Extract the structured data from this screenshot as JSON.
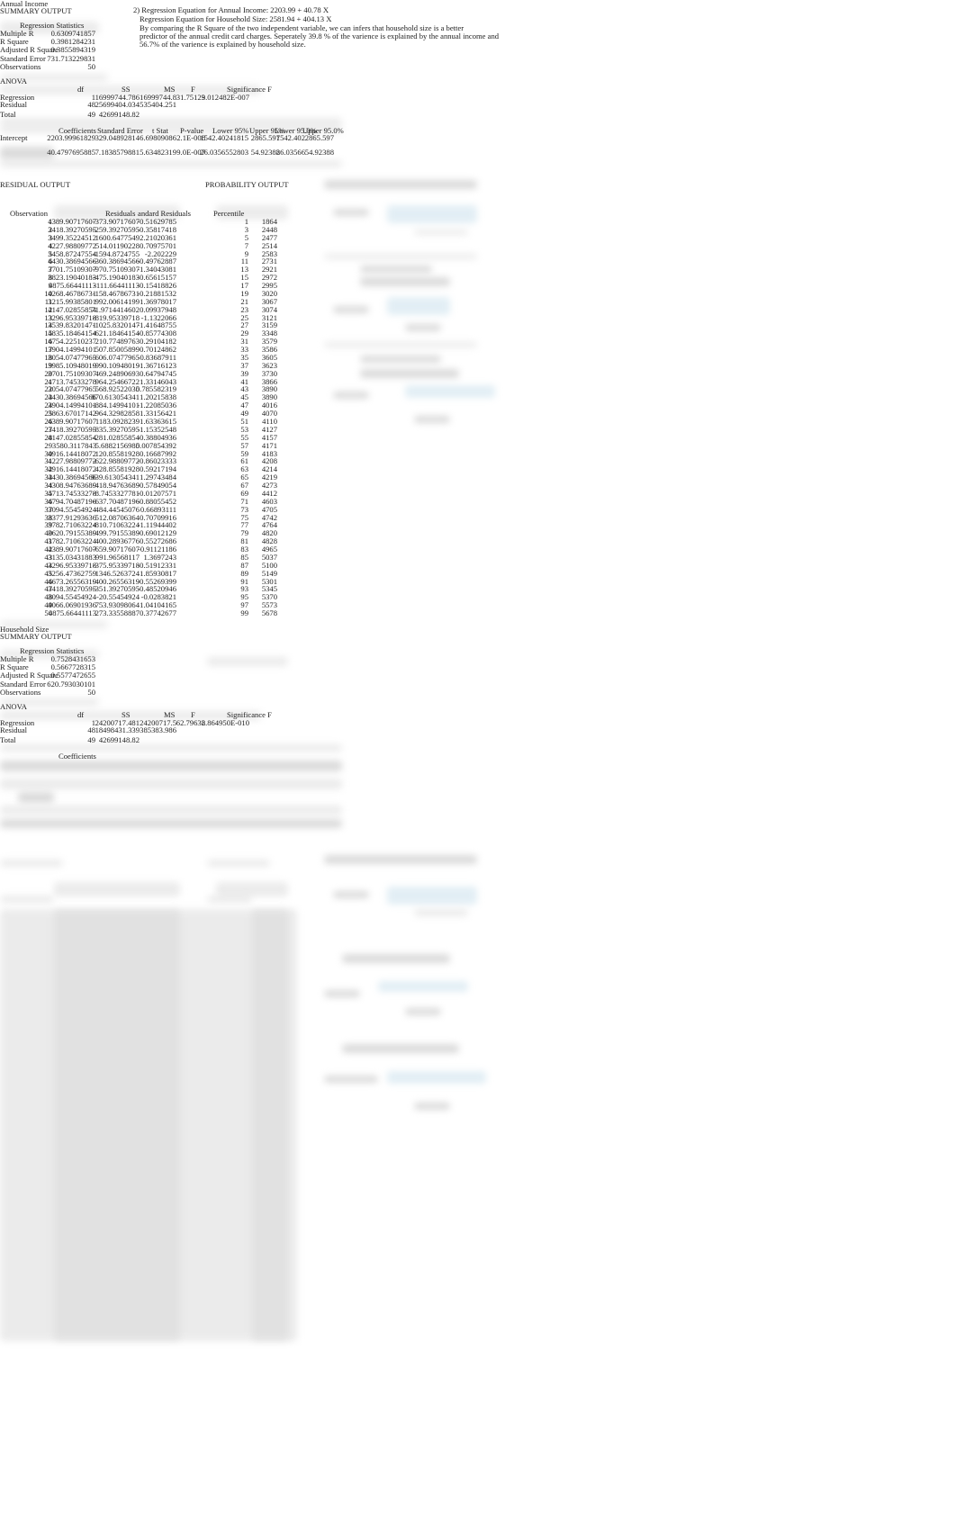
{
  "income": {
    "section_title": "Annual Income",
    "summary_title": "SUMMARY OUTPUT",
    "reg_stats_header": "Regression Statistics",
    "reg_stats": [
      {
        "label": "Multiple R",
        "value": "0.6309741857"
      },
      {
        "label": "R Square",
        "value": "0.3981284231"
      },
      {
        "label": "Adjusted R Square",
        "value": "0.3855894319"
      },
      {
        "label": "Standard Error",
        "value": "731.713229831"
      },
      {
        "label": "Observations",
        "value": "50"
      }
    ],
    "anova_title": "ANOVA",
    "anova_headers": [
      "df",
      "SS",
      "MS",
      "F",
      "Significance F"
    ],
    "anova_rows": [
      {
        "label": "Regression",
        "df": "1",
        "ss": "16999744.786",
        "ms": "16999744.8",
        "f": "31.75123",
        "sig": "9.012482E-007"
      },
      {
        "label": "Residual",
        "df": "48",
        "ss": "25699404.034",
        "ms": "535404.251",
        "f": "",
        "sig": ""
      },
      {
        "label": "Total",
        "df": "49",
        "ss": "42699148.82",
        "ms": "",
        "f": "",
        "sig": ""
      }
    ],
    "coef_headers": [
      "Coefficients",
      "Standard Error",
      "t Stat",
      "P-value",
      "Lower 95%",
      "Upper 95%",
      "Lower 95.0%",
      "Upper 95.0%"
    ],
    "coef_rows": [
      {
        "label": "Intercept",
        "values": [
          "2203.99961829",
          "329.04892814",
          "6.69809086",
          "2.1E-008",
          "1542.40241815",
          "2865.597",
          "1542.402",
          "2865.597"
        ]
      },
      {
        "label": "",
        "values": [
          "40.4797695885",
          "7.1838579881",
          "5.63482319",
          "9.0E-007",
          "26.0356552803",
          "54.92388",
          "26.03566",
          "54.92388"
        ]
      }
    ],
    "residual_title": "RESIDUAL OUTPUT",
    "residual_headers": [
      "Observation",
      "Residuals",
      "andard Residuals"
    ],
    "residual_rows": [
      [
        "1",
        "4389.90717607",
        "-373.90717607",
        "-0.51629785"
      ],
      [
        "2",
        "3418.39270595",
        "-259.39270595",
        "-0.35817418"
      ],
      [
        "3",
        "3499.35224512",
        "1600.6477549",
        "2.21020361"
      ],
      [
        "4",
        "4227.98809772",
        "514.01190228",
        "0.70975701"
      ],
      [
        "5",
        "3458.87247554",
        "-1594.8724755",
        "-2.202229"
      ],
      [
        "6",
        "4430.38694566",
        "-360.38694566",
        "-0.49762887"
      ],
      [
        "7",
        "3701.75109307",
        "-970.75109307",
        "-1.34043081"
      ],
      [
        "8",
        "3823.19040183",
        "-475.19040183",
        "-0.65615157"
      ],
      [
        "9",
        "4875.66441113",
        "-111.66441113",
        "-0.15418826"
      ],
      [
        "10",
        "4268.46786731",
        "-158.46786731",
        "-0.21881532"
      ],
      [
        "11",
        "3215.99385801",
        "992.00614199",
        "1.36978017"
      ],
      [
        "12",
        "4147.02855854",
        "71.9714414602",
        "0.09937948"
      ],
      [
        "13",
        "3296.95339718",
        "-819.95339718",
        "-1.1322066"
      ],
      [
        "14",
        "3539.83201471",
        "-1025.8320147",
        "-1.41648755"
      ],
      [
        "15",
        "4835.18464154",
        "-621.18464154",
        "-0.85774308"
      ],
      [
        "16",
        "4754.22510237",
        "210.77489763",
        "0.29104182"
      ],
      [
        "17",
        "3904.14994101",
        "507.85005899",
        "0.70124862"
      ],
      [
        "18",
        "3054.07477965",
        "-606.07477965",
        "-0.83687911"
      ],
      [
        "19",
        "3985.10948019",
        "-990.10948019",
        "-1.36716123"
      ],
      [
        "20",
        "3701.75109307",
        "469.24890693",
        "0.64794745"
      ],
      [
        "21",
        "4713.74533278",
        "964.25466722",
        "1.33146043"
      ],
      [
        "22",
        "3054.07477965",
        "568.92522035",
        "0.785582319"
      ],
      [
        "23",
        "4430.38694566",
        "870.613054341",
        "1.20215838"
      ],
      [
        "24",
        "3904.14994101",
        "-884.14994101",
        "-1.22085036"
      ],
      [
        "25",
        "3863.67017142",
        "964.32982858",
        "1.33156421"
      ],
      [
        "26",
        "4389.90717607",
        "1183.0928239",
        "1.63363615"
      ],
      [
        "27",
        "3418.39270595",
        "-835.39270595",
        "-1.15352548"
      ],
      [
        "28",
        "4147.02855854",
        "-281.02855854",
        "-0.38804936"
      ],
      [
        "29",
        "3580.3117843",
        "5.6882156985",
        "0.007854392"
      ],
      [
        "30",
        "4916.14418072",
        "120.85581928",
        "0.16687992"
      ],
      [
        "31",
        "4227.98809772",
        "-622.98809772",
        "-0.86023333"
      ],
      [
        "32",
        "4916.14418072",
        "428.85581928",
        "0.59217194"
      ],
      [
        "33",
        "4430.38694566",
        "939.613054341",
        "1.29743484"
      ],
      [
        "34",
        "4308.94763689",
        "-418.94763689",
        "-0.57849054"
      ],
      [
        "35",
        "4713.74533278",
        "-8.7453327781",
        "-0.01207571"
      ],
      [
        "36",
        "4794.70487196",
        "-637.70487196",
        "-0.88055452"
      ],
      [
        "37",
        "3094.55454924",
        "484.44545076",
        "0.66893111"
      ],
      [
        "38",
        "3377.91293636",
        "512.08706364",
        "0.70709916"
      ],
      [
        "39",
        "3782.71063224",
        "-810.71063224",
        "-1.11944402"
      ],
      [
        "40",
        "3620.79155389",
        "-499.79155389",
        "-0.69012129"
      ],
      [
        "41",
        "3782.71063224",
        "400.28936776",
        "0.55272686"
      ],
      [
        "42",
        "4389.90717607",
        "-659.90717607",
        "-0.91121186"
      ],
      [
        "43",
        "3135.03431883",
        "991.96568117",
        "1.3697243"
      ],
      [
        "44",
        "3296.95339718",
        "-375.95339718",
        "-0.51912331"
      ],
      [
        "45",
        "3256.47362759",
        "1346.5263724",
        "1.85930817"
      ],
      [
        "46",
        "4673.26556319",
        "-400.26556319",
        "-0.55269399"
      ],
      [
        "47",
        "3418.39270595",
        "-351.39270595",
        "-0.48520946"
      ],
      [
        "48",
        "3094.55454924",
        "-20.55454924",
        "-0.0283821"
      ],
      [
        "49",
        "4066.06901936",
        "753.93098064",
        "1.04104165"
      ],
      [
        "50",
        "4875.66441113",
        "273.33558887",
        "0.37742677"
      ]
    ],
    "probability_title": "PROBABILITY OUTPUT",
    "probability_header": "Percentile",
    "probability_rows": [
      [
        "1",
        "1864"
      ],
      [
        "3",
        "2448"
      ],
      [
        "5",
        "2477"
      ],
      [
        "7",
        "2514"
      ],
      [
        "9",
        "2583"
      ],
      [
        "11",
        "2731"
      ],
      [
        "13",
        "2921"
      ],
      [
        "15",
        "2972"
      ],
      [
        "17",
        "2995"
      ],
      [
        "19",
        "3020"
      ],
      [
        "21",
        "3067"
      ],
      [
        "23",
        "3074"
      ],
      [
        "25",
        "3121"
      ],
      [
        "27",
        "3159"
      ],
      [
        "29",
        "3348"
      ],
      [
        "31",
        "3579"
      ],
      [
        "33",
        "3586"
      ],
      [
        "35",
        "3605"
      ],
      [
        "37",
        "3623"
      ],
      [
        "39",
        "3730"
      ],
      [
        "41",
        "3866"
      ],
      [
        "43",
        "3890"
      ],
      [
        "45",
        "3890"
      ],
      [
        "47",
        "4016"
      ],
      [
        "49",
        "4070"
      ],
      [
        "51",
        "4110"
      ],
      [
        "53",
        "4127"
      ],
      [
        "55",
        "4157"
      ],
      [
        "57",
        "4171"
      ],
      [
        "59",
        "4183"
      ],
      [
        "61",
        "4208"
      ],
      [
        "63",
        "4214"
      ],
      [
        "65",
        "4219"
      ],
      [
        "67",
        "4273"
      ],
      [
        "69",
        "4412"
      ],
      [
        "71",
        "4603"
      ],
      [
        "73",
        "4705"
      ],
      [
        "75",
        "4742"
      ],
      [
        "77",
        "4764"
      ],
      [
        "79",
        "4820"
      ],
      [
        "81",
        "4828"
      ],
      [
        "83",
        "4965"
      ],
      [
        "85",
        "5037"
      ],
      [
        "87",
        "5100"
      ],
      [
        "89",
        "5149"
      ],
      [
        "91",
        "5301"
      ],
      [
        "93",
        "5345"
      ],
      [
        "95",
        "5370"
      ],
      [
        "97",
        "5573"
      ],
      [
        "99",
        "5678"
      ]
    ]
  },
  "notes": {
    "line1": "2) Regression Equation for Annual Income: 2203.99 + 40.78 X",
    "line2": "Regression Equation for Household Size: 2581.94 + 404.13 X",
    "line3": "By comparing the R Square of the two independent variable, we can infers that household size is a better",
    "line4": "predictor of the annual credit card charges. Seperately 39.8 % of the varience is explained by the annual income and",
    "line5": "56.7% of the varience is explained by household size."
  },
  "household": {
    "section_title": "Household Size",
    "summary_title": "SUMMARY OUTPUT",
    "reg_stats_header": "Regression Statistics",
    "reg_stats": [
      {
        "label": "Multiple R",
        "value": "0.7528431653"
      },
      {
        "label": "R Square",
        "value": "0.5667728315"
      },
      {
        "label": "Adjusted R Square",
        "value": "0.5577472655"
      },
      {
        "label": "Standard Error",
        "value": "620.793030101"
      },
      {
        "label": "Observations",
        "value": "50"
      }
    ],
    "anova_title": "ANOVA",
    "anova_headers": [
      "df",
      "SS",
      "MS",
      "F",
      "Significance F"
    ],
    "anova_rows": [
      {
        "label": "Regression",
        "df": "1",
        "ss": "24200717.481",
        "ms": "24200717.5",
        "f": "62.79638",
        "sig": "2.864950E-010"
      },
      {
        "label": "Residual",
        "df": "48",
        "ss": "18498431.339",
        "ms": "385383.986",
        "f": "",
        "sig": ""
      },
      {
        "label": "Total",
        "df": "49",
        "ss": "42699148.82",
        "ms": "",
        "f": "",
        "sig": ""
      }
    ],
    "coef_header": "Coefficients"
  }
}
